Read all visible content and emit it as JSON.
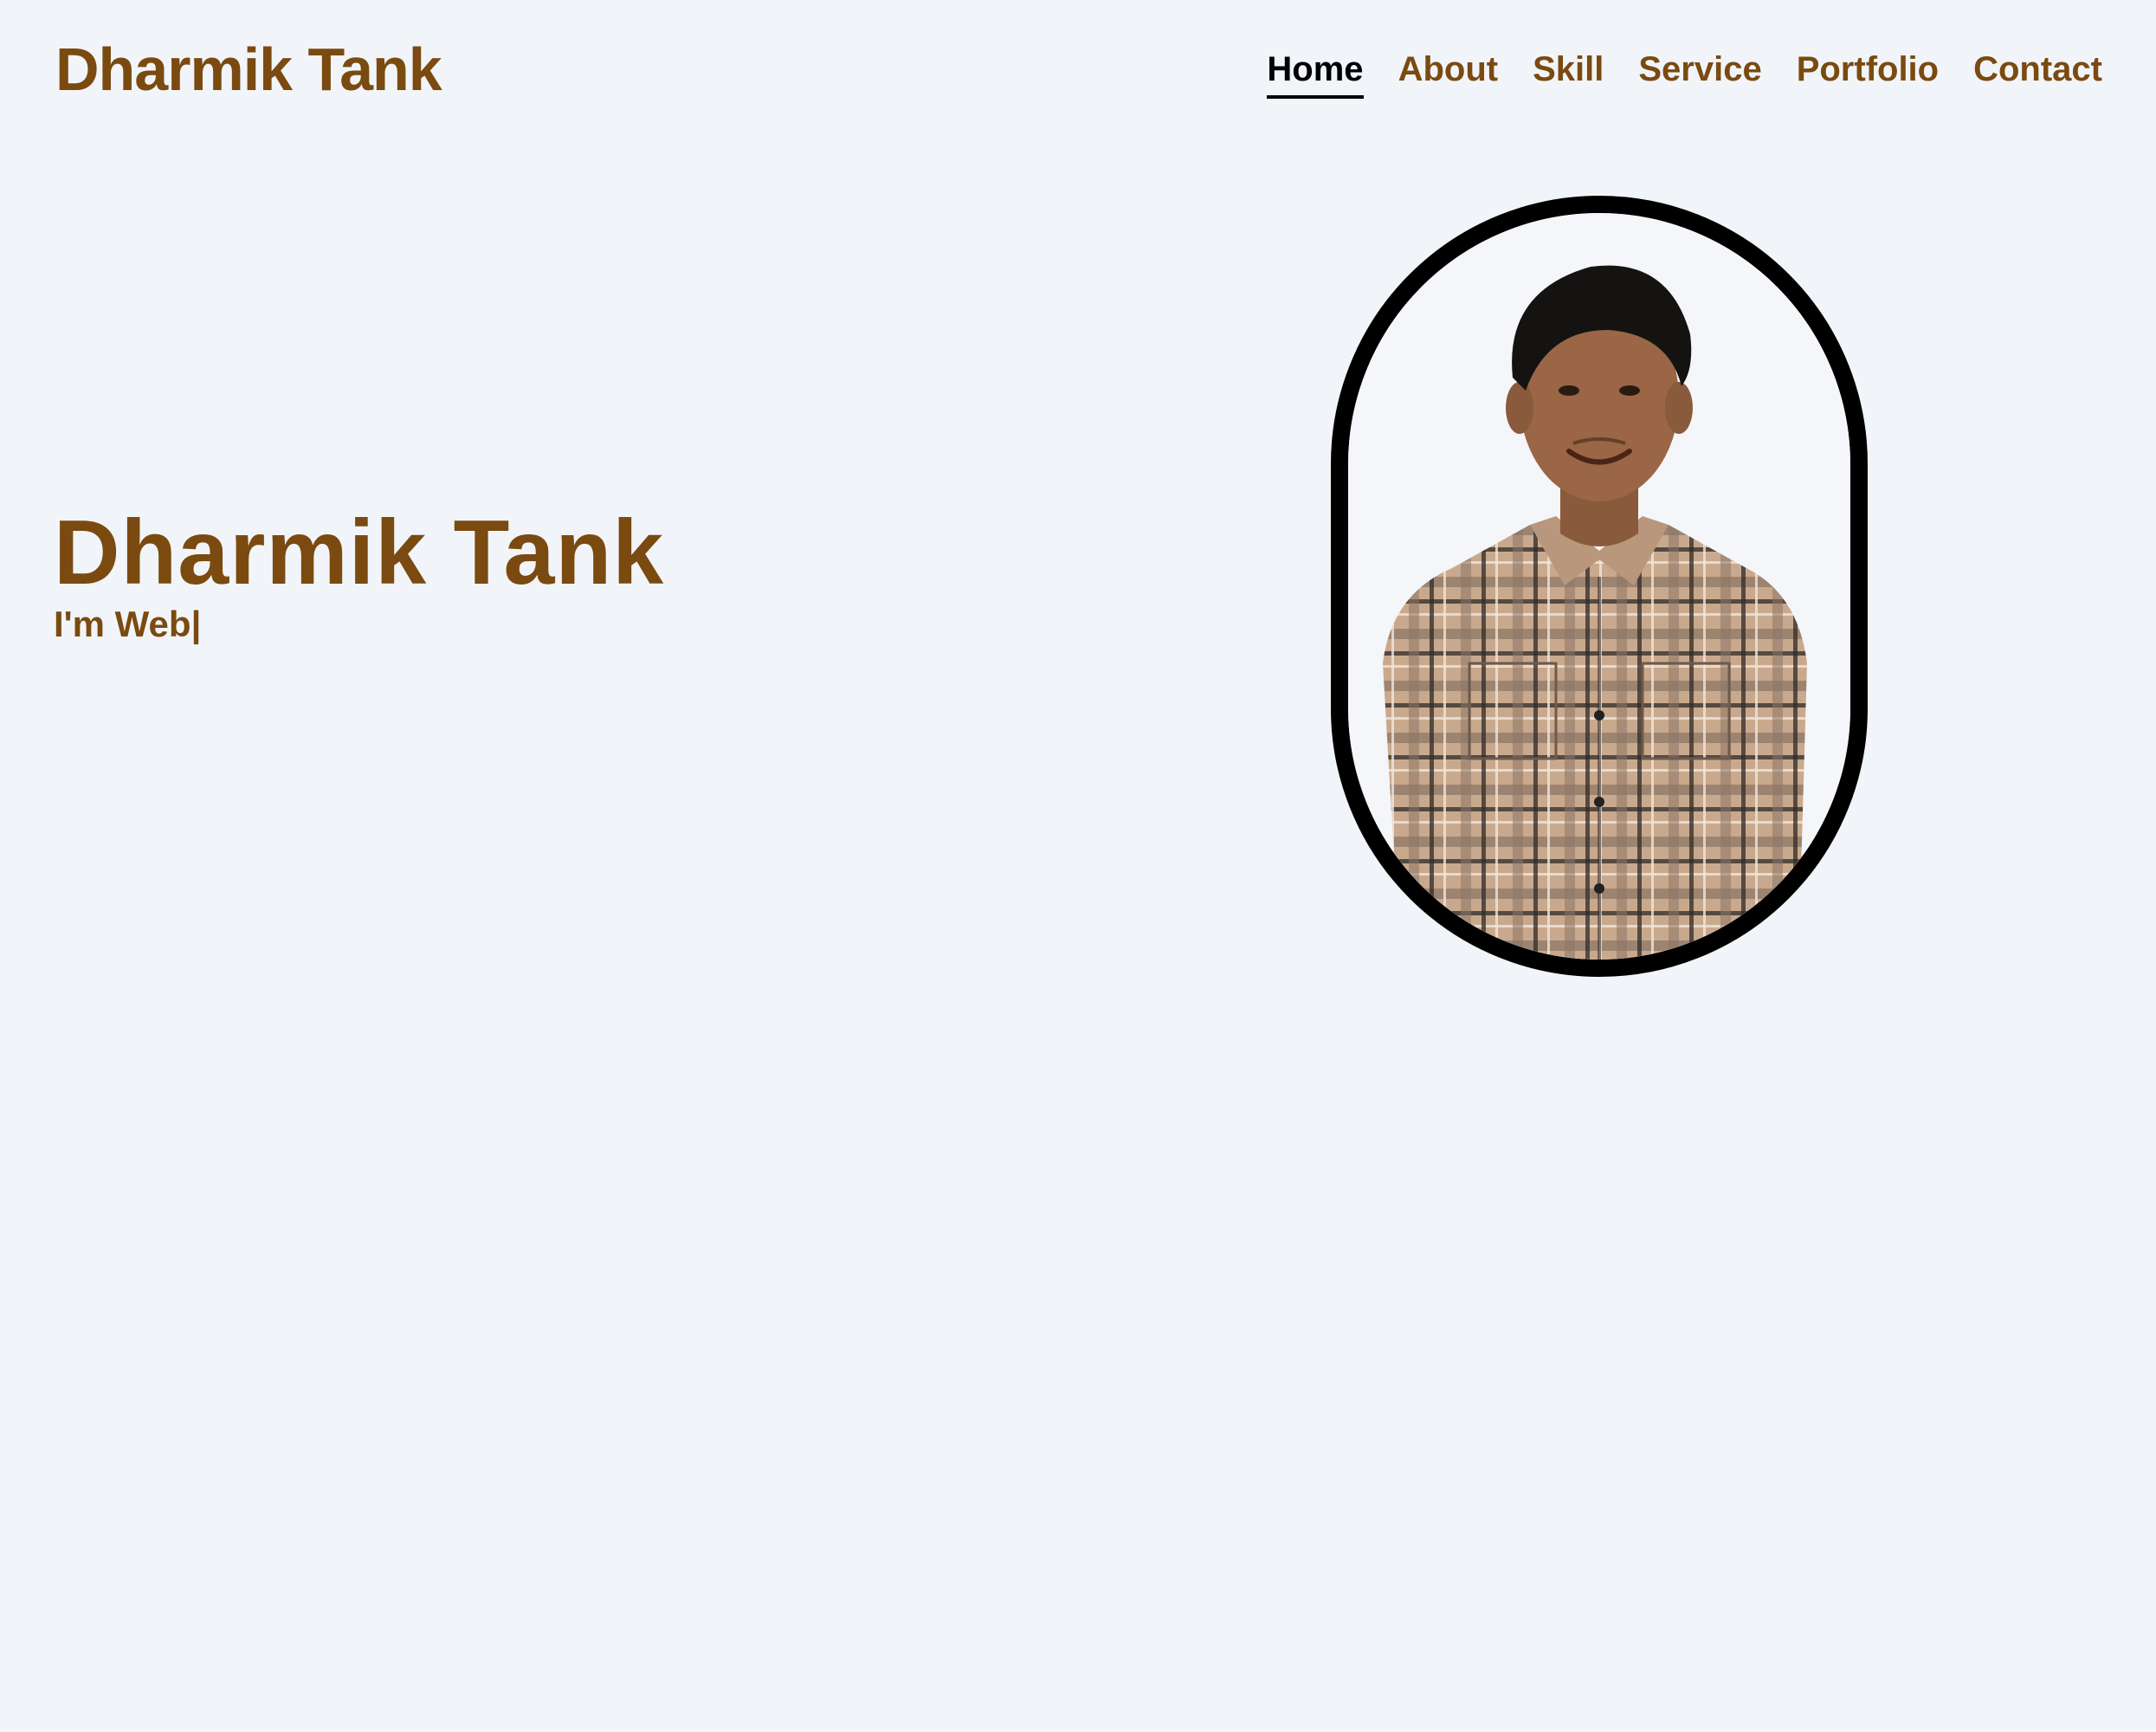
{
  "header": {
    "logo": "Dharmik Tank",
    "nav": [
      {
        "label": "Home",
        "active": true
      },
      {
        "label": "About",
        "active": false
      },
      {
        "label": "Skill",
        "active": false
      },
      {
        "label": "Service",
        "active": false
      },
      {
        "label": "Portfolio",
        "active": false
      },
      {
        "label": "Contact",
        "active": false
      }
    ]
  },
  "hero": {
    "name": "Dharmik Tank",
    "role_text": "I'm Web|"
  },
  "colors": {
    "background": "#f1f5f9",
    "brand_brown": "#7b4a10",
    "active_nav": "#000000",
    "frame": "#000000"
  }
}
